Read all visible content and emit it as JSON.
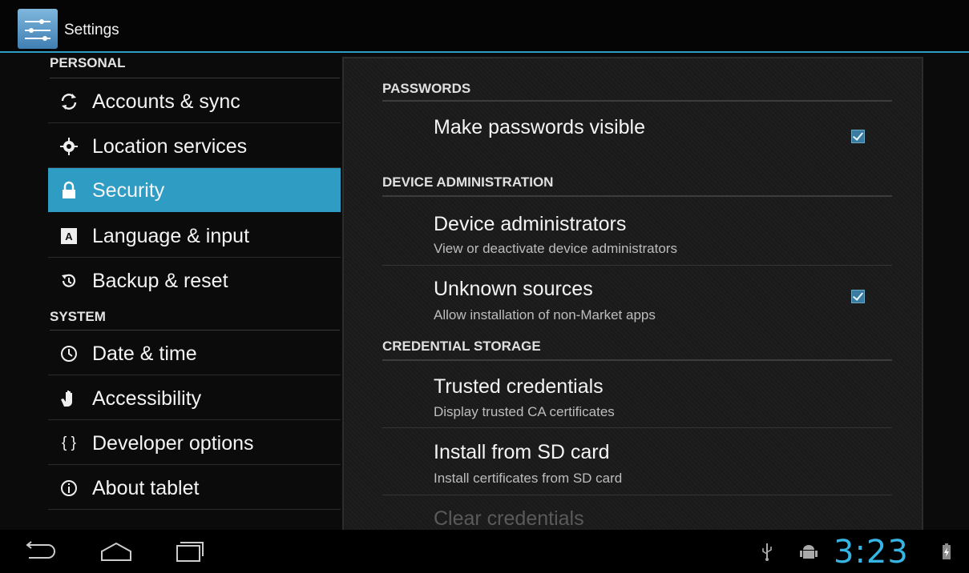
{
  "app": {
    "title": "Settings",
    "icon": "settings-icon"
  },
  "sidebar": {
    "personal_header": "PERSONAL",
    "system_header": "SYSTEM",
    "items": [
      {
        "label": "Accounts & sync",
        "icon": "sync-icon"
      },
      {
        "label": "Location services",
        "icon": "location-icon"
      },
      {
        "label": "Security",
        "icon": "lock-icon",
        "selected": true
      },
      {
        "label": "Language & input",
        "icon": "keyboard-icon"
      },
      {
        "label": "Backup & reset",
        "icon": "backup-icon"
      },
      {
        "label": "Date & time",
        "icon": "clock-icon"
      },
      {
        "label": "Accessibility",
        "icon": "hand-icon"
      },
      {
        "label": "Developer options",
        "icon": "braces-icon",
        "glyph": "{ }"
      },
      {
        "label": "About tablet",
        "icon": "info-icon"
      }
    ]
  },
  "main": {
    "passwords_header": "PASSWORDS",
    "make_passwords_visible": {
      "title": "Make passwords visible",
      "checked": true
    },
    "device_admin_header": "DEVICE ADMINISTRATION",
    "device_administrators": {
      "title": "Device administrators",
      "summary": "View or deactivate device administrators"
    },
    "unknown_sources": {
      "title": "Unknown sources",
      "summary": "Allow installation of non-Market apps",
      "checked": true
    },
    "credential_header": "CREDENTIAL STORAGE",
    "trusted_credentials": {
      "title": "Trusted credentials",
      "summary": "Display trusted CA certificates"
    },
    "install_sd": {
      "title": "Install from SD card",
      "summary": "Install certificates from SD card"
    },
    "clear_credentials": {
      "title": "Clear credentials",
      "enabled": false
    }
  },
  "system_bar": {
    "clock": "3:23",
    "icons": [
      "back-icon",
      "home-icon",
      "recent-apps-icon",
      "usb-icon",
      "android-debug-icon",
      "battery-charging-icon"
    ]
  },
  "colors": {
    "accent": "#2f9cc4",
    "clock": "#36b5e5"
  }
}
